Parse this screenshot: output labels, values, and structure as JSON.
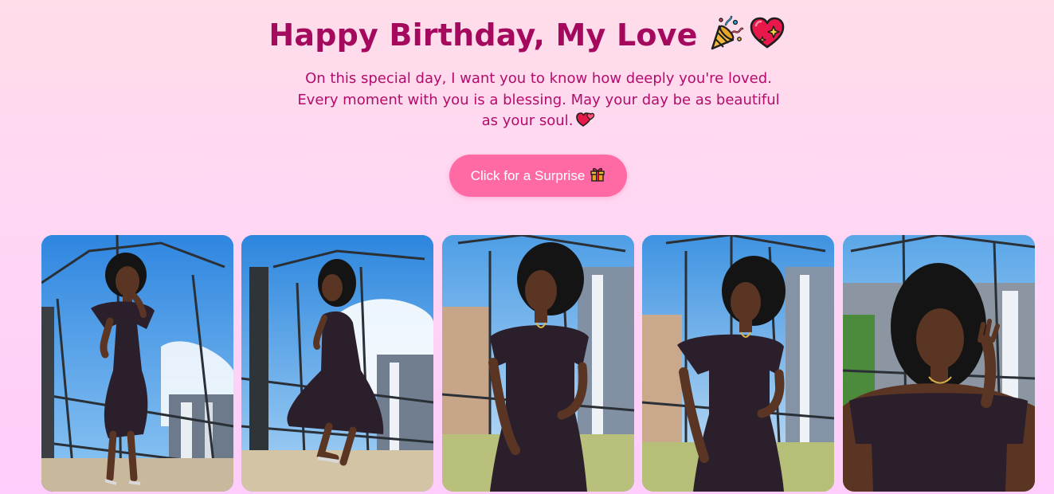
{
  "page": {
    "title": "Happy Birthday, My Love",
    "title_emojis": [
      "party-popper-icon",
      "sparkling-heart-icon"
    ],
    "message": "On this special day, I want you to know how deeply you're loved. Every moment with you is a blessing. May your day be as beautiful as your soul.",
    "message_emoji": "two-hearts-icon"
  },
  "surprise_button": {
    "label": "Click for a Surprise",
    "icon": "gift-icon"
  },
  "gallery": {
    "photos": [
      {
        "pose": "standing-full"
      },
      {
        "pose": "crouching"
      },
      {
        "pose": "standing-closer"
      },
      {
        "pose": "standing-hand-hip"
      },
      {
        "pose": "closeup-hand-hair"
      }
    ]
  },
  "colors": {
    "title": "#a4095e",
    "message": "#b30c6b",
    "button_bg": "#ff6aa5",
    "button_text": "#ffffff",
    "dress": "#2b1f2c",
    "sky": "#4f9be4"
  }
}
